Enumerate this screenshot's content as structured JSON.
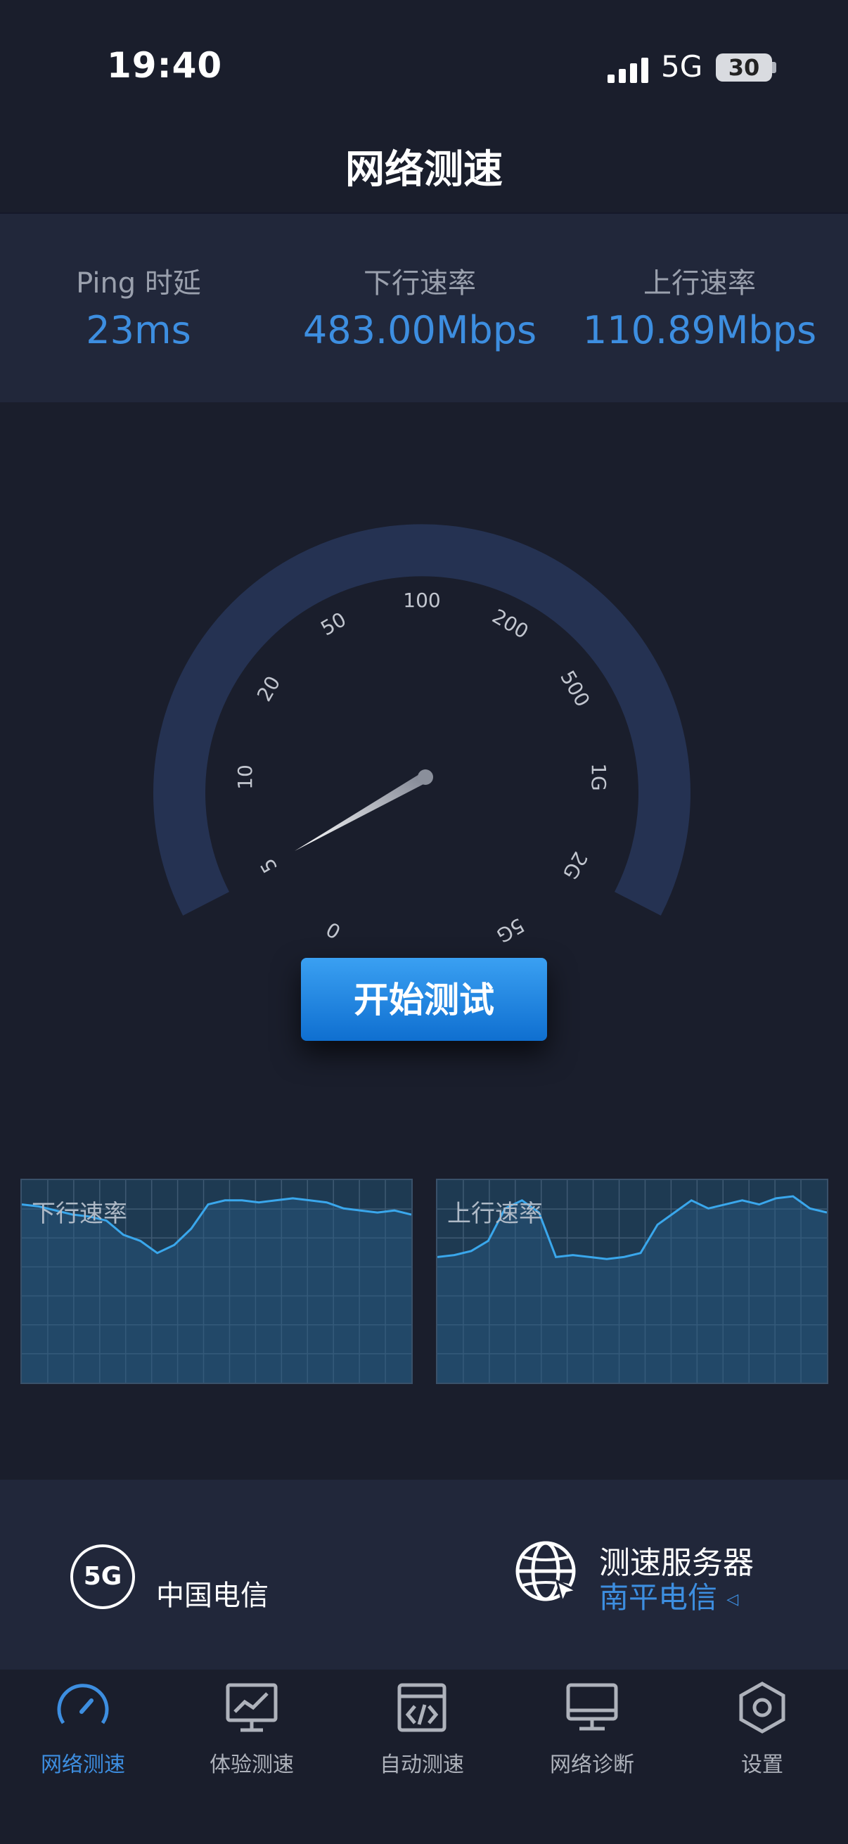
{
  "status_bar": {
    "time": "19:40",
    "network": "5G",
    "battery": "30"
  },
  "header": {
    "title": "网络测速"
  },
  "metrics": [
    {
      "label": "Ping 时延",
      "value": "23ms"
    },
    {
      "label": "下行速率",
      "value": "483.00Mbps"
    },
    {
      "label": "上行速率",
      "value": "110.89Mbps"
    }
  ],
  "gauge": {
    "scale": [
      "0",
      "5",
      "10",
      "20",
      "50",
      "100",
      "200",
      "500",
      "1G",
      "2G",
      "5G"
    ]
  },
  "start_button": {
    "label": "开始测试"
  },
  "charts": {
    "download_label": "下行速率",
    "upload_label": "上行速率"
  },
  "info": {
    "network_badge": "5G",
    "carrier": "中国电信",
    "server_title": "测速服务器",
    "server_name": "南平电信"
  },
  "tabs": [
    {
      "label": "网络测速",
      "icon": "gauge-icon",
      "active": true
    },
    {
      "label": "体验测速",
      "icon": "chart-icon",
      "active": false
    },
    {
      "label": "自动测速",
      "icon": "code-window-icon",
      "active": false
    },
    {
      "label": "网络诊断",
      "icon": "monitor-icon",
      "active": false
    },
    {
      "label": "设置",
      "icon": "hexagon-settings-icon",
      "active": false
    }
  ],
  "colors": {
    "accent": "#3d8ee0",
    "background": "#1a1e2c",
    "panel": "#21273a",
    "gauge_arc": "#253252"
  }
}
